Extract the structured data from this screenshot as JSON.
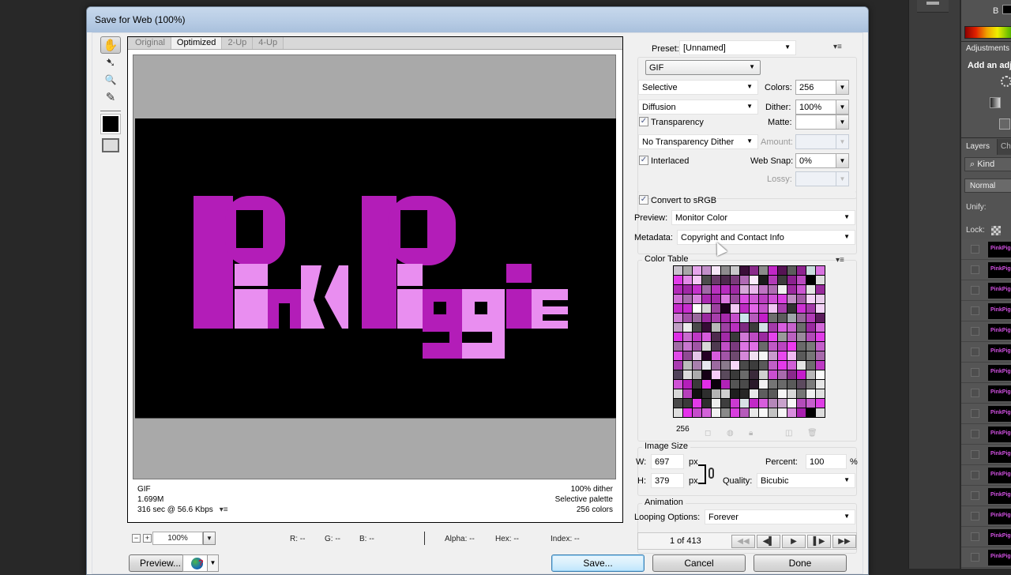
{
  "window": {
    "title": "Save for Web (100%)"
  },
  "tools": [
    {
      "name": "hand-tool",
      "glyph": "✋"
    },
    {
      "name": "slice-select-tool",
      "glyph": "➷"
    },
    {
      "name": "zoom-tool",
      "glyph": "🔍"
    },
    {
      "name": "eyedropper-tool",
      "glyph": "✎"
    }
  ],
  "view_tabs": [
    "Original",
    "Optimized",
    "2-Up",
    "4-Up"
  ],
  "active_tab": "Optimized",
  "preview": {
    "image_text": "Pink Piggie",
    "colors": {
      "dark_magenta": "#b31db8",
      "light_pink": "#e98ef0",
      "background": "#000000"
    },
    "info_left": [
      "GIF",
      "1.699M",
      "316 sec @ 56.6 Kbps"
    ],
    "info_right": [
      "100% dither",
      "Selective palette",
      "256 colors"
    ]
  },
  "statusbar": {
    "zoom_value": "100%",
    "r": "R: --",
    "g": "G: --",
    "b": "B: --",
    "alpha": "Alpha: --",
    "hex": "Hex: --",
    "index": "Index: --"
  },
  "buttons": {
    "preview": "Preview...",
    "save": "Save...",
    "cancel": "Cancel",
    "done": "Done"
  },
  "settings": {
    "preset_label": "Preset:",
    "preset_value": "[Unnamed]",
    "format": "GIF",
    "reduction": "Selective",
    "colors_label": "Colors:",
    "colors_value": "256",
    "dither_algo": "Diffusion",
    "dither_label": "Dither:",
    "dither_value": "100%",
    "transparency_label": "Transparency",
    "transparency_checked": true,
    "matte_label": "Matte:",
    "matte_value": "",
    "trans_dither": "No Transparency Dither",
    "amount_label": "Amount:",
    "amount_value": "",
    "interlaced_label": "Interlaced",
    "interlaced_checked": true,
    "websnap_label": "Web Snap:",
    "websnap_value": "0%",
    "lossy_label": "Lossy:",
    "lossy_value": "",
    "convert_srgb_label": "Convert to sRGB",
    "convert_srgb_checked": true,
    "preview_label": "Preview:",
    "preview_value": "Monitor Color",
    "metadata_label": "Metadata:",
    "metadata_value": "Copyright and Contact Info"
  },
  "color_table": {
    "title": "Color Table",
    "count": "256",
    "palette": [
      "#c9c2cd",
      "#a8a6a8",
      "#e6a5ec",
      "#c28fc9",
      "#f6e6f8",
      "#8e8c8e",
      "#c9c8ca",
      "#3a0e38",
      "#8a2a8b",
      "#8b8b8b",
      "#c126c7",
      "#561455",
      "#5c5c5c",
      "#8e2490",
      "#c9dcde",
      "#d873e0",
      "#e23ce9",
      "#e38ae8",
      "#f4c8f5",
      "#4c4c4c",
      "#6a3a6a",
      "#4e2a4e",
      "#7a3a7a",
      "#b06ab4",
      "#fbeafd",
      "#1a1a1a",
      "#b23bb7",
      "#3c3c3c",
      "#8b218f",
      "#ba4bbf",
      "#000000",
      "#dedede",
      "#b22ab8",
      "#9f27a5",
      "#c431cb",
      "#a06aa6",
      "#b831be",
      "#b82cc0",
      "#9e2aa3",
      "#d7a8da",
      "#e9b8ec",
      "#bf74c3",
      "#b06cb4",
      "#f0f0f0",
      "#9c2a9f",
      "#cb56d1",
      "#e4e4e4",
      "#982b9b",
      "#cf6fd5",
      "#a86cad",
      "#d884dd",
      "#aa2ab0",
      "#a42aa9",
      "#dc7ae1",
      "#9b4b9e",
      "#da4fe1",
      "#cf5ad5",
      "#bb3fc1",
      "#d052d6",
      "#da3fe1",
      "#c08ec3",
      "#a35ba6",
      "#f3d2f5",
      "#e9cdeb",
      "#c52ccb",
      "#c82ecf",
      "#ffffff",
      "#d5d5d5",
      "#9c439f",
      "#1c001c",
      "#f3c9f5",
      "#bd2bc3",
      "#e267e8",
      "#c552cb",
      "#f0c4f3",
      "#a73fac",
      "#323232",
      "#cd30d3",
      "#a43aa9",
      "#f3d3f6",
      "#cd7ed3",
      "#a352a7",
      "#9a6a9e",
      "#9a2aa0",
      "#a73fac",
      "#a72aac",
      "#c54ecb",
      "#cce4ec",
      "#b55bbb",
      "#c31ec9",
      "#6e6e6e",
      "#5c5c5c",
      "#9ea6a9",
      "#956a98",
      "#b13bb6",
      "#5c1c5c",
      "#c0a0c4",
      "#ececec",
      "#4a4a4a",
      "#360c36",
      "#b8b8b8",
      "#9d41a2",
      "#b930bf",
      "#7e2a82",
      "#3c3c3c",
      "#d2e0e6",
      "#a43aa9",
      "#d85ddf",
      "#c762cd",
      "#6d6d6d",
      "#9a2aa0",
      "#d369d9",
      "#dc2ee4",
      "#c96bcf",
      "#bf38c5",
      "#d65bdc",
      "#4e2a4e",
      "#a22aa7",
      "#3a3a3a",
      "#d178d6",
      "#bd4bc3",
      "#9b2aa0",
      "#e542ec",
      "#9a9a9a",
      "#bb61c1",
      "#9a8a9c",
      "#b14bb7",
      "#e03de7",
      "#a16ca5",
      "#c877ce",
      "#a055a5",
      "#d8d8d8",
      "#4e3a50",
      "#c04fc6",
      "#7a3a7e",
      "#dc75e2",
      "#df6fe5",
      "#6a6a6a",
      "#bf59c5",
      "#bb45c1",
      "#ec3aef",
      "#6a6a6a",
      "#7a7a7a",
      "#c45ecb",
      "#e04ae7",
      "#8f4a93",
      "#e4c6e8",
      "#240024",
      "#d65cdc",
      "#a255a7",
      "#6e4a70",
      "#d487d9",
      "#f0dff1",
      "#f6f6f6",
      "#c99acd",
      "#e948ef",
      "#f0b8f2",
      "#5a5a5a",
      "#767676",
      "#a86aac",
      "#a93ab0",
      "#bcbcbc",
      "#a980ae",
      "#e8e8f0",
      "#9c6aa0",
      "#8a7a8c",
      "#f8d8f9",
      "#4a4a4a",
      "#3c3c3c",
      "#5a5a5a",
      "#c05fc6",
      "#e43aea",
      "#d05fd6",
      "#e4e4e4",
      "#6e6e6e",
      "#bd3ac3",
      "#50425a",
      "#dcdcdc",
      "#acacac",
      "#160016",
      "#f5ccf7",
      "#5a4a5c",
      "#3a3a3a",
      "#6a6a6a",
      "#3a2a3a",
      "#d0d0d0",
      "#ca4fd0",
      "#a96aad",
      "#8a2a8c",
      "#c51ecb",
      "#b8b8b8",
      "#fafafa",
      "#cf52d5",
      "#b41ebb",
      "#3a3a3a",
      "#e12ee8",
      "#0c000c",
      "#b023b7",
      "#555555",
      "#4a4a4a",
      "#2a1a2a",
      "#f2f2f2",
      "#757575",
      "#6a6a6a",
      "#5a5a5a",
      "#5c4a5e",
      "#7a7a7a",
      "#e6e6e6",
      "#d8d8d8",
      "#b63fbb",
      "#101010",
      "#2e2e2e",
      "#b4b4b4",
      "#cfcfcf",
      "#1e1e1e",
      "#262626",
      "#e8e8e8",
      "#5e5e5e",
      "#5a5a5a",
      "#f6f6f6",
      "#d8d8d8",
      "#767676",
      "#eeeeee",
      "#e0e0e0",
      "#4a4a4a",
      "#3a3a3a",
      "#e33ae9",
      "#2e2e2e",
      "#ededed",
      "#3e3e3e",
      "#cb3ad1",
      "#d8e0e6",
      "#c128c7",
      "#d75edc",
      "#b487b8",
      "#c9a2cc",
      "#f7f7f7",
      "#b44bba",
      "#c65fcc",
      "#de3ee5",
      "#dedede",
      "#e531eb",
      "#c64bcc",
      "#d363d9",
      "#f2f2f2",
      "#8a8a8a",
      "#d83ede",
      "#b65bbb",
      "#e8e8e8",
      "#f8f8f8",
      "#c2c2c2",
      "#f6f6f6",
      "#d88ddd",
      "#a81eae",
      "#000000",
      "#dcdcdc"
    ]
  },
  "image_size": {
    "title": "Image Size",
    "w_label": "W:",
    "w_value": "697",
    "h_label": "H:",
    "h_value": "379",
    "unit": "px",
    "percent_label": "Percent:",
    "percent_value": "100",
    "percent_unit": "%",
    "quality_label": "Quality:",
    "quality_value": "Bicubic"
  },
  "animation": {
    "title": "Animation",
    "looping_label": "Looping Options:",
    "looping_value": "Forever",
    "frame_counter": "1 of 413"
  },
  "photoshop_panel": {
    "b_label": "B",
    "adjustments_tab": "Adjustments",
    "adjustments_hint": "Add an adjustment",
    "layers_tab": "Layers",
    "channels_tab": "Channels",
    "kind_filter": "Kind",
    "blend_mode": "Normal",
    "unify_label": "Unify:",
    "lock_label": "Lock:",
    "layer_thumb_text": "PinkPiggie",
    "layer_count_visible": 16
  }
}
